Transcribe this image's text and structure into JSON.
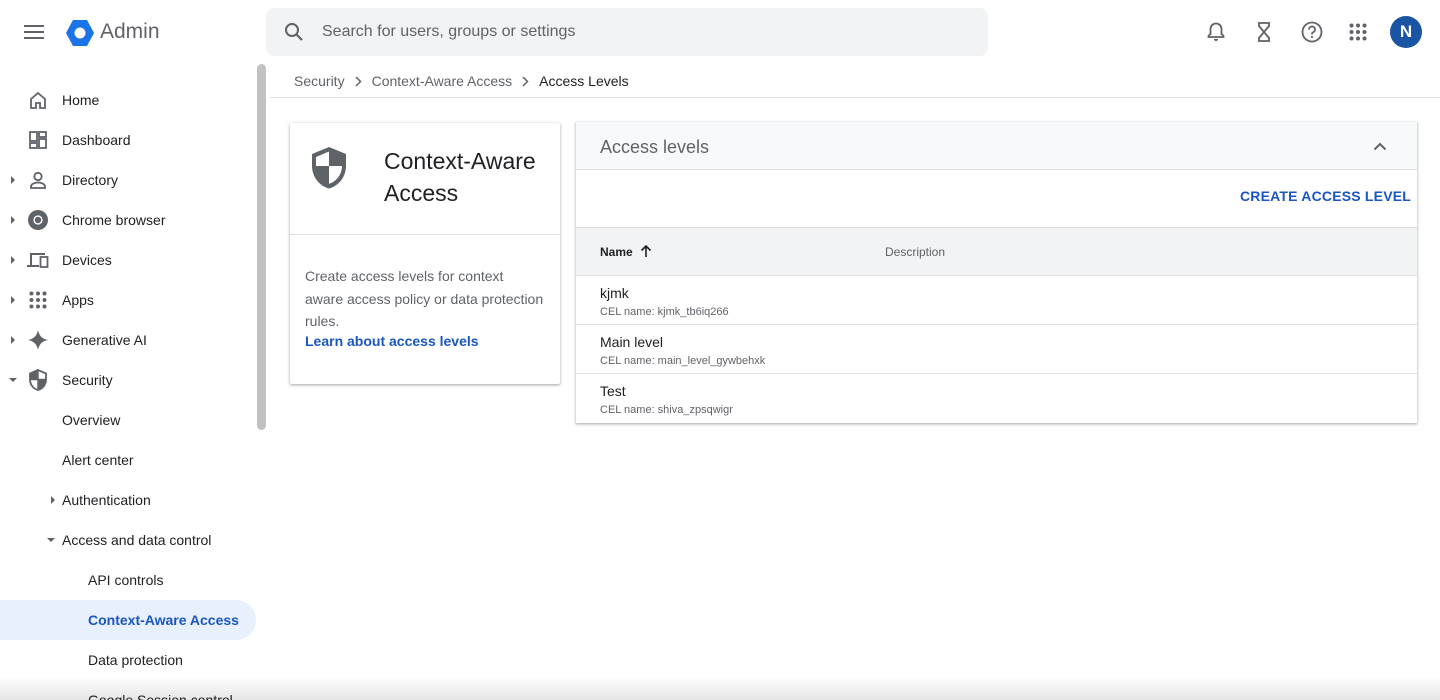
{
  "app": {
    "brand": "Admin",
    "logo_icon": "admin-hexagon-logo",
    "brand_color": "#1a73e8"
  },
  "search": {
    "placeholder": "Search for users, groups or settings"
  },
  "topbar": {
    "icons": [
      "notifications-icon",
      "tasks-hourglass-icon",
      "help-icon",
      "apps-grid-icon"
    ],
    "avatar_initial": "N"
  },
  "sidebar": {
    "items": [
      {
        "label": "Home",
        "icon": "home-icon"
      },
      {
        "label": "Dashboard",
        "icon": "dashboard-icon"
      },
      {
        "label": "Directory",
        "icon": "person-icon"
      },
      {
        "label": "Chrome browser",
        "icon": "chrome-icon"
      },
      {
        "label": "Devices",
        "icon": "devices-icon"
      },
      {
        "label": "Apps",
        "icon": "apps-grid-icon"
      },
      {
        "label": "Generative AI",
        "icon": "sparkle-icon"
      },
      {
        "label": "Security",
        "icon": "shield-icon"
      },
      {
        "label": "Overview"
      },
      {
        "label": "Alert center"
      },
      {
        "label": "Authentication"
      },
      {
        "label": "Access and data control"
      },
      {
        "label": "API controls"
      },
      {
        "label": "Context-Aware Access"
      },
      {
        "label": "Data protection"
      },
      {
        "label": "Google Session control"
      }
    ]
  },
  "breadcrumb": [
    "Security",
    "Context-Aware Access",
    "Access Levels"
  ],
  "info_card": {
    "title": "Context-Aware Access",
    "description": "Create access levels for context aware access policy or data protection rules.",
    "link": "Learn about access levels"
  },
  "panel": {
    "title": "Access levels",
    "create_button": "CREATE ACCESS LEVEL",
    "columns": {
      "name": "Name",
      "description": "Description"
    },
    "rows": [
      {
        "name": "kjmk",
        "cel": "CEL name: kjmk_tb6iq266"
      },
      {
        "name": "Main level",
        "cel": "CEL name: main_level_gywbehxk"
      },
      {
        "name": "Test",
        "cel": "CEL name: shiva_zpsqwigr"
      }
    ]
  },
  "colors": {
    "accent": "#1a56c2",
    "active_bg": "#e8f0fe",
    "avatar": "#1a55a4"
  }
}
